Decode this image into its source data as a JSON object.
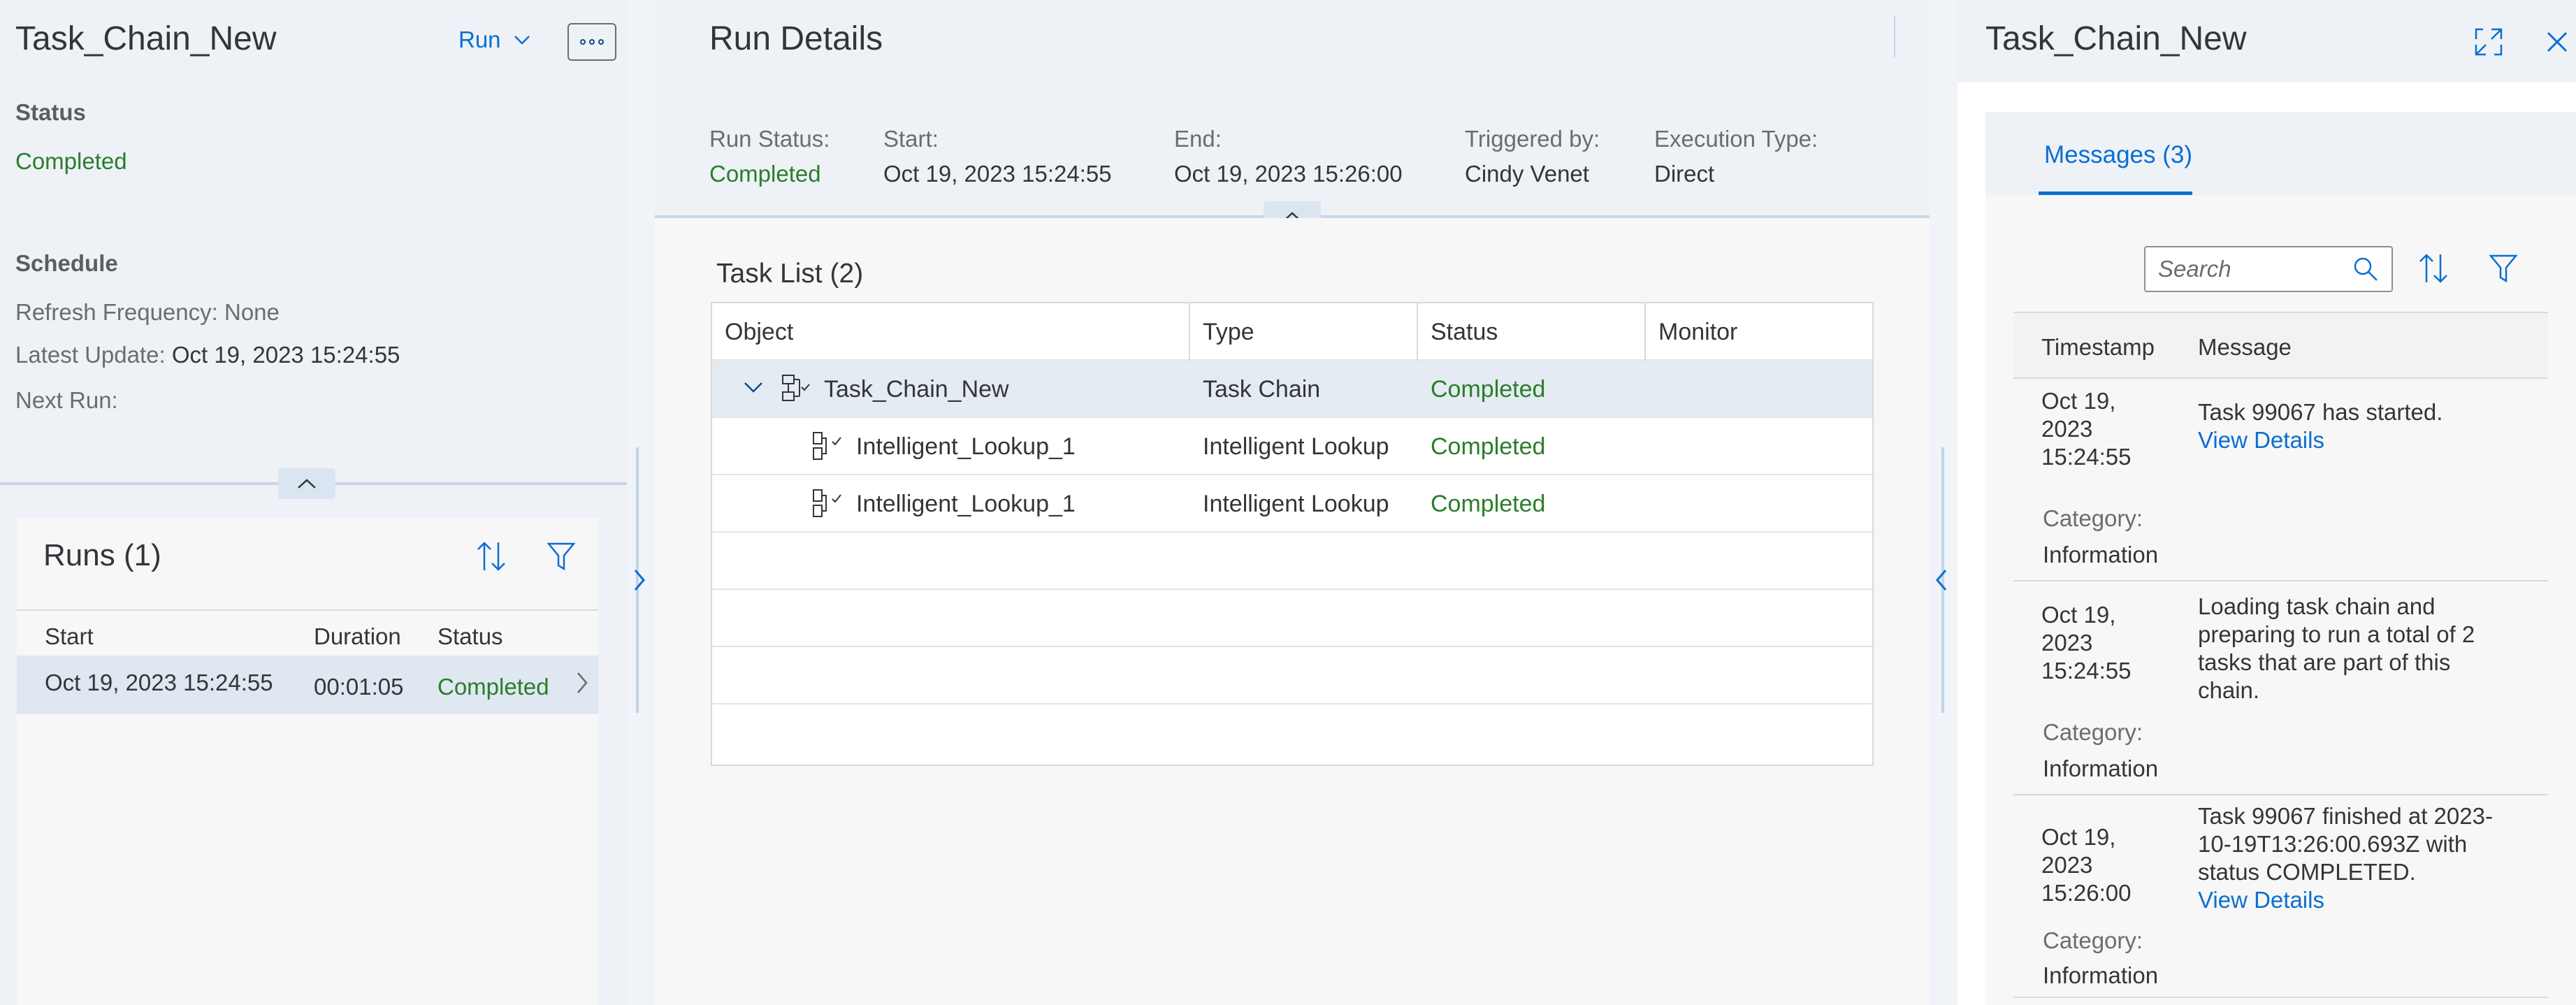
{
  "left": {
    "title": "Task_Chain_New",
    "run_label": "Run",
    "status_label": "Status",
    "status_value": "Completed",
    "schedule_label": "Schedule",
    "refresh_label": "Refresh Frequency:",
    "refresh_value": "None",
    "latest_label": "Latest Update:",
    "latest_value": "Oct 19, 2023 15:24:55",
    "next_label": "Next Run:",
    "runs": {
      "title": "Runs (1)",
      "columns": [
        "Start",
        "Duration",
        "Status"
      ],
      "rows": [
        {
          "start": "Oct 19, 2023 15:24:55",
          "duration": "00:01:05",
          "status": "Completed"
        }
      ]
    }
  },
  "middle": {
    "title": "Run Details",
    "header": {
      "run_status_label": "Run Status:",
      "run_status_value": "Completed",
      "start_label": "Start:",
      "start_value": "Oct 19, 2023 15:24:55",
      "end_label": "End:",
      "end_value": "Oct 19, 2023 15:26:00",
      "triggered_label": "Triggered by:",
      "triggered_value": "Cindy Venet",
      "exec_label": "Execution Type:",
      "exec_value": "Direct"
    },
    "task_list": {
      "title": "Task List (2)",
      "columns": [
        "Object",
        "Type",
        "Status",
        "Monitor"
      ],
      "rows": [
        {
          "object": "Task_Chain_New",
          "type": "Task Chain",
          "status": "Completed"
        },
        {
          "object": "Intelligent_Lookup_1",
          "type": "Intelligent Lookup",
          "status": "Completed"
        },
        {
          "object": "Intelligent_Lookup_1",
          "type": "Intelligent Lookup",
          "status": "Completed"
        }
      ]
    }
  },
  "right": {
    "title": "Task_Chain_New",
    "tab_label": "Messages (3)",
    "search_placeholder": "Search",
    "columns": [
      "Timestamp",
      "Message"
    ],
    "messages": [
      {
        "date": "Oct 19,",
        "year": "2023",
        "time": "15:24:55",
        "category_label": "Category:",
        "category": "Information",
        "lines": [
          "Task 99067 has started."
        ],
        "link": "View Details"
      },
      {
        "date": "Oct 19,",
        "year": "2023",
        "time": "15:24:55",
        "category_label": "Category:",
        "category": "Information",
        "lines": [
          "Loading task chain and",
          "preparing to run a total of 2",
          "tasks that are part of this",
          "chain."
        ],
        "link": ""
      },
      {
        "date": "Oct 19,",
        "year": "2023",
        "time": "15:26:00",
        "category_label": "Category:",
        "category": "Information",
        "lines": [
          "Task 99067 finished at 2023-",
          "10-19T13:26:00.693Z with",
          "status COMPLETED."
        ],
        "link": "View Details"
      }
    ]
  },
  "colors": {
    "accent": "#0a6ed1",
    "success": "#2b7d2b",
    "selection": "#dfe7f1"
  }
}
